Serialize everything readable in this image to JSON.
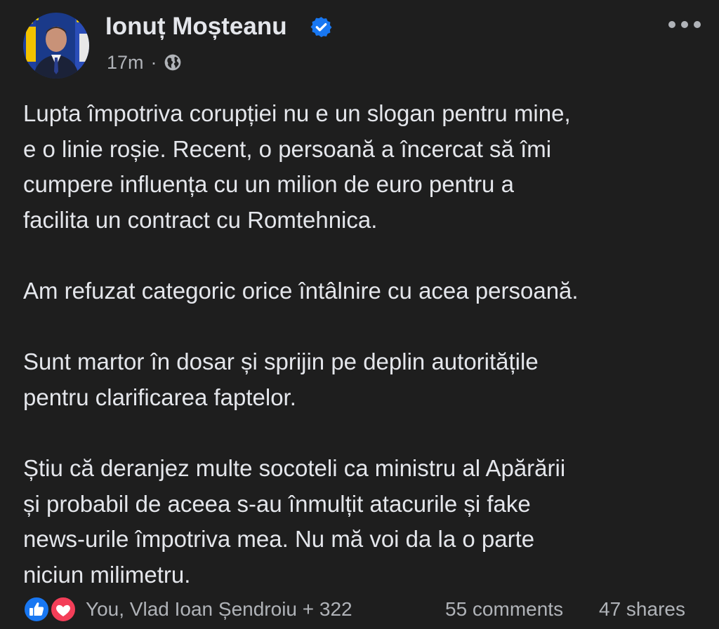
{
  "author": {
    "name": "Ionuț Moșteanu",
    "verified_icon": "verified-badge-icon"
  },
  "meta": {
    "time": "17m",
    "separator": "·",
    "audience_icon": "globe-icon"
  },
  "menu_icon": "more-options-icon",
  "body": {
    "paragraphs": [
      "Lupta împotriva corupției nu e un slogan pentru mine,\ne o linie roșie. Recent, o persoană a încercat să îmi\ncumpere influența cu un milion de euro pentru a\nfacilita un contract cu Romtehnica.",
      "Am refuzat categoric orice întâlnire cu acea persoană.",
      "Sunt martor în dosar și sprijin pe deplin autoritățile\npentru clarificarea faptelor.",
      "Știu că deranjez multe socoteli ca ministru al Apărării\nși probabil de aceea s-au înmulțit atacurile și fake\nnews-urile împotriva mea. Nu mă voi da la o parte\nniciun milimetru."
    ]
  },
  "footer": {
    "reaction_icons": [
      "like-icon",
      "love-icon"
    ],
    "reactions_text": "You, Vlad Ioan Șendroiu + 322",
    "comments": "55 comments",
    "shares": "47 shares"
  },
  "colors": {
    "background": "#1e1e1e",
    "primary_text": "#e4e6eb",
    "secondary_text": "#b0b3b8",
    "verified_blue": "#1877f2",
    "like_blue": "#1877f2",
    "love_red": "#f33e58"
  }
}
